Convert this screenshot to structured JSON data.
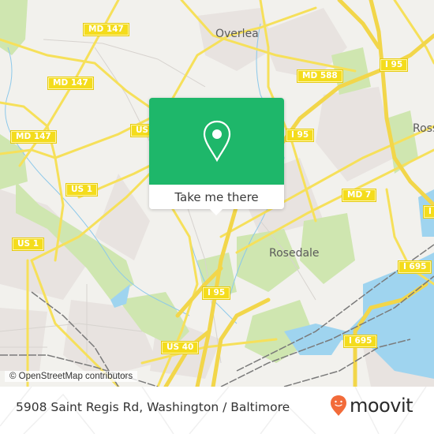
{
  "map": {
    "route_shields": [
      {
        "id": "md147-a",
        "label": "MD 147"
      },
      {
        "id": "md147-b",
        "label": "MD 147"
      },
      {
        "id": "md147-c",
        "label": "MD 147"
      },
      {
        "id": "us-a",
        "label": "US"
      },
      {
        "id": "us1-a",
        "label": "US 1"
      },
      {
        "id": "us1-b",
        "label": "US 1"
      },
      {
        "id": "md588",
        "label": "MD 588"
      },
      {
        "id": "i95-a",
        "label": "I 95"
      },
      {
        "id": "i95-b",
        "label": "I 95"
      },
      {
        "id": "i95-c",
        "label": "I 95"
      },
      {
        "id": "md7",
        "label": "MD 7"
      },
      {
        "id": "i695-a",
        "label": "I 695"
      },
      {
        "id": "i695-b",
        "label": "I 695"
      },
      {
        "id": "us40",
        "label": "US 40"
      },
      {
        "id": "i-edge",
        "label": "I"
      }
    ],
    "places": [
      {
        "id": "overlea",
        "label": "Overlea"
      },
      {
        "id": "rosedale",
        "label": "Rosedale"
      },
      {
        "id": "ross",
        "label": "Ross"
      }
    ],
    "attribution": "© OpenStreetMap contributors",
    "colors": {
      "land": "#f2f1ed",
      "road": "#f6e05a",
      "park": "#cfe6b0",
      "water": "#9fd4ef",
      "urban": "#e8e3e0",
      "rail": "#7a7a7a"
    }
  },
  "popup": {
    "icon": "location-pin-icon",
    "button_label": "Take me there",
    "accent_color": "#1eb76a"
  },
  "footer": {
    "address": "5908 Saint Regis Rd, Washington / Baltimore",
    "brand": "moovit",
    "brand_color": "#f26b3a"
  }
}
